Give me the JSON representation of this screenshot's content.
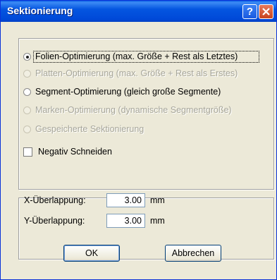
{
  "window": {
    "title": "Sektionierung",
    "help_glyph": "?"
  },
  "options": [
    {
      "label": "Folien-Optimierung (max. Größe + Rest als Letztes)",
      "checked": true,
      "enabled": true
    },
    {
      "label": "Platten-Optimierung (max. Größe + Rest als Erstes)",
      "checked": false,
      "enabled": false
    },
    {
      "label": "Segment-Optimierung (gleich große Segmente)",
      "checked": false,
      "enabled": true
    },
    {
      "label": "Marken-Optimierung (dynamische Segmentgröße)",
      "checked": false,
      "enabled": false
    },
    {
      "label": "Gespeicherte Sektionierung",
      "checked": false,
      "enabled": false
    }
  ],
  "negativ_checkbox": {
    "label": "Negativ Schneiden",
    "checked": false
  },
  "overlap": {
    "x_label": "X-Überlappung:",
    "x_value": "3.00",
    "y_label": "Y-Überlappung:",
    "y_value": "3.00",
    "unit": "mm"
  },
  "buttons": {
    "ok": "OK",
    "cancel": "Abbrechen"
  },
  "colors": {
    "titlebar": "#0052e0",
    "face": "#ece9d8",
    "disabled_text": "#a7a69a",
    "close": "#d5532f"
  }
}
